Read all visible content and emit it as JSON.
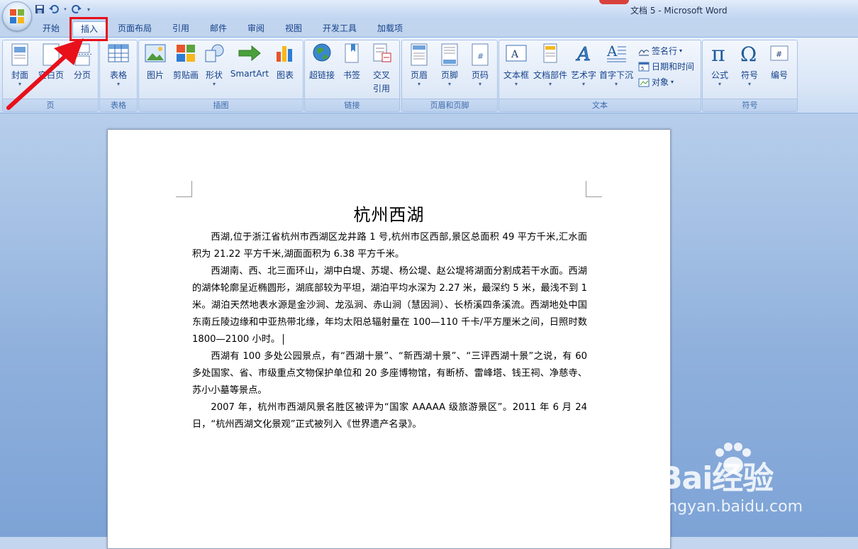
{
  "window": {
    "title": "文档 5 - Microsoft Word"
  },
  "tabs": [
    "开始",
    "插入",
    "页面布局",
    "引用",
    "邮件",
    "审阅",
    "视图",
    "开发工具",
    "加载项"
  ],
  "active_tab": "插入",
  "ribbon": {
    "groups": {
      "page": {
        "label": "页",
        "buttons": [
          "封面",
          "空白页",
          "分页"
        ]
      },
      "table": {
        "label": "表格",
        "buttons": [
          "表格"
        ]
      },
      "illustrations": {
        "label": "插图",
        "buttons": [
          "图片",
          "剪贴画",
          "形状",
          "SmartArt",
          "图表"
        ]
      },
      "links": {
        "label": "链接",
        "buttons": [
          "超链接",
          "书签",
          "交叉",
          "引用"
        ]
      },
      "header_footer": {
        "label": "页眉和页脚",
        "buttons": [
          "页眉",
          "页脚",
          "页码"
        ]
      },
      "text": {
        "label": "文本",
        "buttons": [
          "文本框",
          "文档部件",
          "艺术字",
          "首字下沉"
        ],
        "small": [
          "签名行",
          "日期和时间",
          "对象"
        ]
      },
      "symbols": {
        "label": "符号",
        "buttons": [
          "公式",
          "符号",
          "编号"
        ]
      }
    }
  },
  "document": {
    "title": "杭州西湖",
    "paragraphs": [
      "西湖,位于浙江省杭州市西湖区龙井路 1 号,杭州市区西部,景区总面积 49 平方千米,汇水面积为 21.22 平方千米,湖面面积为 6.38 平方千米。",
      "西湖南、西、北三面环山，湖中白堤、苏堤、杨公堤、赵公堤将湖面分割成若干水面。西湖的湖体轮廓呈近椭圆形，湖底部较为平坦，湖泊平均水深为 2.27 米，最深约 5 米，最浅不到 1 米。湖泊天然地表水源是金沙涧、龙泓涧、赤山涧（慧因涧）、长桥溪四条溪流。西湖地处中国东南丘陵边缘和中亚热带北缘，年均太阳总辐射量在 100—110 千卡/平方厘米之间，日照时数 1800—2100 小时。",
      "西湖有 100 多处公园景点，有“西湖十景”、“新西湖十景”、“三评西湖十景”之说，有 60 多处国家、省、市级重点文物保护单位和 20 多座博物馆，有断桥、雷峰塔、钱王祠、净慈寺、苏小小墓等景点。",
      "2007 年，杭州市西湖风景名胜区被评为“国家 AAAAA 级旅游景区”。2011 年 6 月 24 日，“杭州西湖文化景观”正式被列入《世界遗产名录》。"
    ]
  },
  "watermark": {
    "brand": "Bai经验",
    "url": "jingyan.baidu.com"
  },
  "colors": {
    "ribbon_text": "#15428b",
    "highlight_box": "#e8101a",
    "arrow": "#e8101a"
  }
}
